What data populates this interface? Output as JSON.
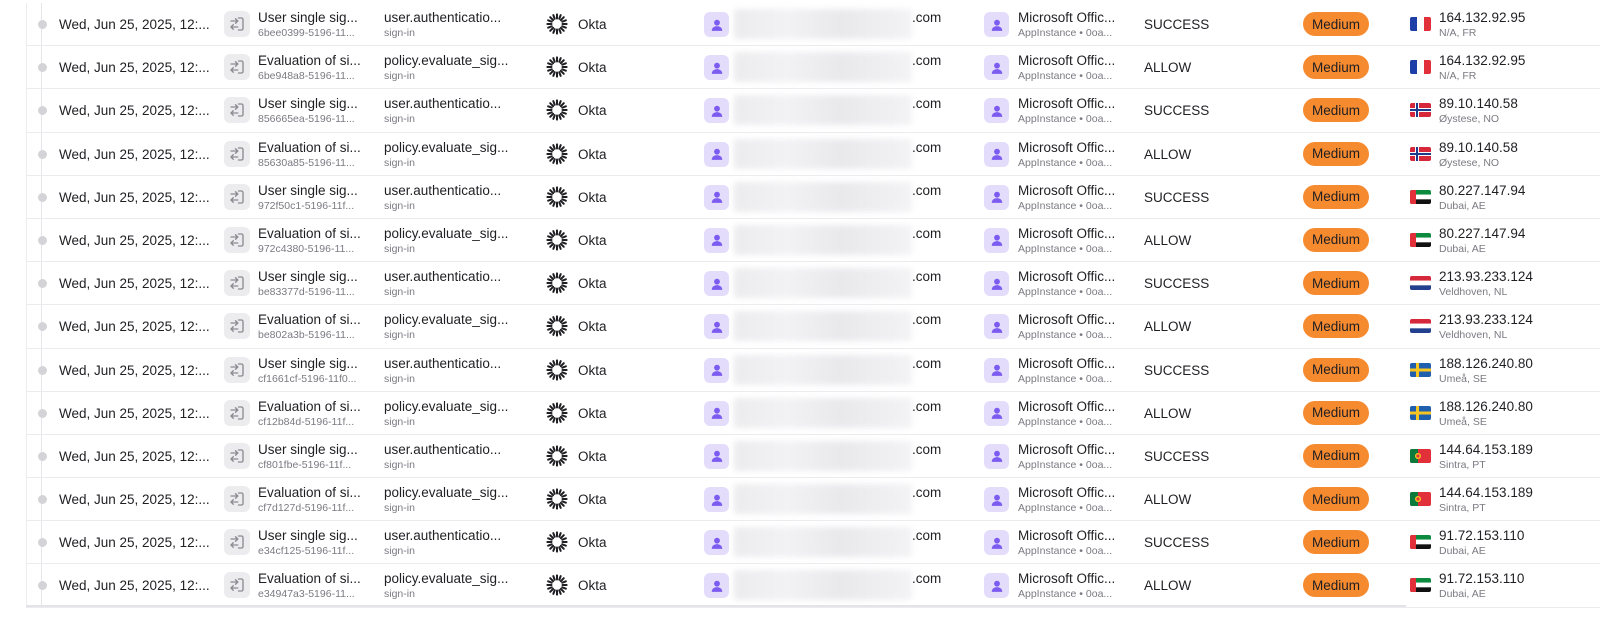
{
  "table": {
    "rows": [
      {
        "time": "Wed, Jun 25, 2025, 12:...",
        "event_title": "User single sig...",
        "event_id": "6bee0399-5196-11...",
        "type_title": "user.authenticatio...",
        "type_sub": "sign-in",
        "actor_label": "Okta",
        "user_suffix": ".com",
        "app_title": "Microsoft Offic...",
        "app_sub": "AppInstance • 0oa...",
        "result": "SUCCESS",
        "severity": "Medium",
        "ip": "164.132.92.95",
        "location": "N/A, FR",
        "flag": "fr"
      },
      {
        "time": "Wed, Jun 25, 2025, 12:...",
        "event_title": "Evaluation of si...",
        "event_id": "6be948a8-5196-11...",
        "type_title": "policy.evaluate_sig...",
        "type_sub": "sign-in",
        "actor_label": "Okta",
        "user_suffix": ".com",
        "app_title": "Microsoft Offic...",
        "app_sub": "AppInstance • 0oa...",
        "result": "ALLOW",
        "severity": "Medium",
        "ip": "164.132.92.95",
        "location": "N/A, FR",
        "flag": "fr"
      },
      {
        "time": "Wed, Jun 25, 2025, 12:...",
        "event_title": "User single sig...",
        "event_id": "856665ea-5196-11...",
        "type_title": "user.authenticatio...",
        "type_sub": "sign-in",
        "actor_label": "Okta",
        "user_suffix": ".com",
        "app_title": "Microsoft Offic...",
        "app_sub": "AppInstance • 0oa...",
        "result": "SUCCESS",
        "severity": "Medium",
        "ip": "89.10.140.58",
        "location": "Øystese, NO",
        "flag": "no"
      },
      {
        "time": "Wed, Jun 25, 2025, 12:...",
        "event_title": "Evaluation of si...",
        "event_id": "85630a85-5196-11...",
        "type_title": "policy.evaluate_sig...",
        "type_sub": "sign-in",
        "actor_label": "Okta",
        "user_suffix": ".com",
        "app_title": "Microsoft Offic...",
        "app_sub": "AppInstance • 0oa...",
        "result": "ALLOW",
        "severity": "Medium",
        "ip": "89.10.140.58",
        "location": "Øystese, NO",
        "flag": "no"
      },
      {
        "time": "Wed, Jun 25, 2025, 12:...",
        "event_title": "User single sig...",
        "event_id": "972f50c1-5196-11f...",
        "type_title": "user.authenticatio...",
        "type_sub": "sign-in",
        "actor_label": "Okta",
        "user_suffix": ".com",
        "app_title": "Microsoft Offic...",
        "app_sub": "AppInstance • 0oa...",
        "result": "SUCCESS",
        "severity": "Medium",
        "ip": "80.227.147.94",
        "location": "Dubai, AE",
        "flag": "ae"
      },
      {
        "time": "Wed, Jun 25, 2025, 12:...",
        "event_title": "Evaluation of si...",
        "event_id": "972c4380-5196-11...",
        "type_title": "policy.evaluate_sig...",
        "type_sub": "sign-in",
        "actor_label": "Okta",
        "user_suffix": ".com",
        "app_title": "Microsoft Offic...",
        "app_sub": "AppInstance • 0oa...",
        "result": "ALLOW",
        "severity": "Medium",
        "ip": "80.227.147.94",
        "location": "Dubai, AE",
        "flag": "ae"
      },
      {
        "time": "Wed, Jun 25, 2025, 12:...",
        "event_title": "User single sig...",
        "event_id": "be83377d-5196-11...",
        "type_title": "user.authenticatio...",
        "type_sub": "sign-in",
        "actor_label": "Okta",
        "user_suffix": ".com",
        "app_title": "Microsoft Offic...",
        "app_sub": "AppInstance • 0oa...",
        "result": "SUCCESS",
        "severity": "Medium",
        "ip": "213.93.233.124",
        "location": "Veldhoven, NL",
        "flag": "nl"
      },
      {
        "time": "Wed, Jun 25, 2025, 12:...",
        "event_title": "Evaluation of si...",
        "event_id": "be802a3b-5196-11...",
        "type_title": "policy.evaluate_sig...",
        "type_sub": "sign-in",
        "actor_label": "Okta",
        "user_suffix": ".com",
        "app_title": "Microsoft Offic...",
        "app_sub": "AppInstance • 0oa...",
        "result": "ALLOW",
        "severity": "Medium",
        "ip": "213.93.233.124",
        "location": "Veldhoven, NL",
        "flag": "nl"
      },
      {
        "time": "Wed, Jun 25, 2025, 12:...",
        "event_title": "User single sig...",
        "event_id": "cf1661cf-5196-11f0...",
        "type_title": "user.authenticatio...",
        "type_sub": "sign-in",
        "actor_label": "Okta",
        "user_suffix": ".com",
        "app_title": "Microsoft Offic...",
        "app_sub": "AppInstance • 0oa...",
        "result": "SUCCESS",
        "severity": "Medium",
        "ip": "188.126.240.80",
        "location": "Umeå, SE",
        "flag": "se"
      },
      {
        "time": "Wed, Jun 25, 2025, 12:...",
        "event_title": "Evaluation of si...",
        "event_id": "cf12b84d-5196-11f...",
        "type_title": "policy.evaluate_sig...",
        "type_sub": "sign-in",
        "actor_label": "Okta",
        "user_suffix": ".com",
        "app_title": "Microsoft Offic...",
        "app_sub": "AppInstance • 0oa...",
        "result": "ALLOW",
        "severity": "Medium",
        "ip": "188.126.240.80",
        "location": "Umeå, SE",
        "flag": "se"
      },
      {
        "time": "Wed, Jun 25, 2025, 12:...",
        "event_title": "User single sig...",
        "event_id": "cf801fbe-5196-11f...",
        "type_title": "user.authenticatio...",
        "type_sub": "sign-in",
        "actor_label": "Okta",
        "user_suffix": ".com",
        "app_title": "Microsoft Offic...",
        "app_sub": "AppInstance • 0oa...",
        "result": "SUCCESS",
        "severity": "Medium",
        "ip": "144.64.153.189",
        "location": "Sintra, PT",
        "flag": "pt"
      },
      {
        "time": "Wed, Jun 25, 2025, 12:...",
        "event_title": "Evaluation of si...",
        "event_id": "cf7d127d-5196-11f...",
        "type_title": "policy.evaluate_sig...",
        "type_sub": "sign-in",
        "actor_label": "Okta",
        "user_suffix": ".com",
        "app_title": "Microsoft Offic...",
        "app_sub": "AppInstance • 0oa...",
        "result": "ALLOW",
        "severity": "Medium",
        "ip": "144.64.153.189",
        "location": "Sintra, PT",
        "flag": "pt"
      },
      {
        "time": "Wed, Jun 25, 2025, 12:...",
        "event_title": "User single sig...",
        "event_id": "e34cf125-5196-11f...",
        "type_title": "user.authenticatio...",
        "type_sub": "sign-in",
        "actor_label": "Okta",
        "user_suffix": ".com",
        "app_title": "Microsoft Offic...",
        "app_sub": "AppInstance • 0oa...",
        "result": "SUCCESS",
        "severity": "Medium",
        "ip": "91.72.153.110",
        "location": "Dubai, AE",
        "flag": "ae"
      },
      {
        "time": "Wed, Jun 25, 2025, 12:...",
        "event_title": "Evaluation of si...",
        "event_id": "e34947a3-5196-11...",
        "type_title": "policy.evaluate_sig...",
        "type_sub": "sign-in",
        "actor_label": "Okta",
        "user_suffix": ".com",
        "app_title": "Microsoft Offic...",
        "app_sub": "AppInstance • 0oa...",
        "result": "ALLOW",
        "severity": "Medium",
        "ip": "91.72.153.110",
        "location": "Dubai, AE",
        "flag": "ae"
      }
    ]
  },
  "colors": {
    "severity_badge": "#f58a2f",
    "user_icon_bg": "#e4dcfb",
    "user_icon_fg": "#7c5cf0"
  },
  "icons": {
    "event": "sign-in-arrow-icon",
    "actor": "okta-sunburst-icon",
    "user": "person-icon",
    "app": "person-icon"
  }
}
